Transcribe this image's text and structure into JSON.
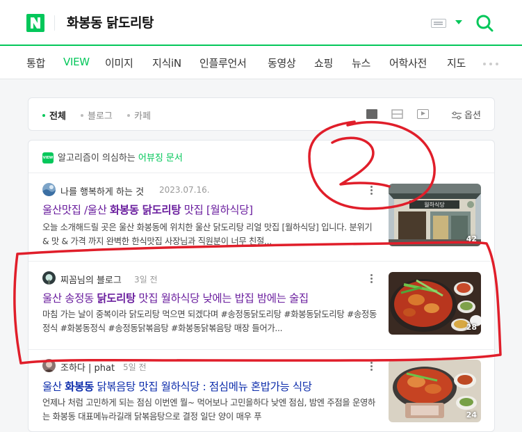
{
  "header": {
    "logo": "N",
    "query": "화봉동 닭도리탕",
    "brand_color": "#03c75a"
  },
  "tabs": [
    {
      "label": "통합"
    },
    {
      "label": "VIEW"
    },
    {
      "label": "이미지"
    },
    {
      "label": "지식iN"
    },
    {
      "label": "인플루언서"
    },
    {
      "label": "동영상"
    },
    {
      "label": "쇼핑"
    },
    {
      "label": "뉴스"
    },
    {
      "label": "어학사전"
    },
    {
      "label": "지도"
    }
  ],
  "filter": {
    "items": [
      {
        "label": "전체"
      },
      {
        "label": "블로그"
      },
      {
        "label": "카페"
      }
    ],
    "option_label": "옵션"
  },
  "notice": {
    "badge": "VIEW",
    "prefix": "알고리즘이 의심하는 ",
    "link": "어뷰징 문서"
  },
  "results": [
    {
      "author": "나를 행복하게 하는 것",
      "date": "2023.07.16.",
      "title_parts": [
        "울산맛집 /울산 ",
        "화봉동 닭도리탕",
        " 맛집 [월하식당]"
      ],
      "desc": "오늘 소개해드릴 곳은 울산 화봉동에 위치한 울산 닭도리탕 리얼 맛집 [월하식당] 입니다. 분위기 & 맛 & 가격 까지 완벽한 한식맛집 사장님과 직원분이 너무 친절...",
      "thumb_count": "42"
    },
    {
      "author": "찌꼼님의 블로그",
      "date": "3일 전",
      "title_parts": [
        "울산 송정동 ",
        "닭도리탕",
        " 맛집 월하식당 낮에는 밥집 밤에는 술집"
      ],
      "desc": "마침 가는 날이 중복이라 닭도리탕 먹으면 되겠다며 #송정동닭도리탕 #화봉동닭도리탕 #송정동정식 #화봉동정식 #송정동닭볶음탕 #화봉동닭볶음탕 매장 들어가...",
      "thumb_count": "28"
    },
    {
      "author": "조하다 | phat",
      "date": "5일 전",
      "title_parts": [
        "울산 ",
        "화봉동",
        " 닭볶음탕 맛집 월하식당 : 점심메뉴 혼밥가능 식당"
      ],
      "desc": "언제나 처럼 고민하게 되는 점심 이번엔 뭘~ 먹어보나 고민을하다 낮엔 점심, 밤엔 주점을 운영하는 화봉동 대표메뉴라길래 닭볶음탕으로 결정 일단 양이 매우 푸",
      "thumb_count": "24"
    }
  ],
  "annotation": {
    "number": "2",
    "color": "#e01e2a"
  }
}
